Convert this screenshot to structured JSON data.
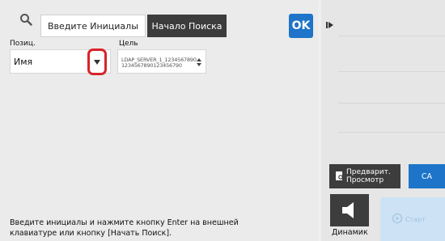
{
  "search": {
    "placeholder": "Введите Инициалы",
    "start_button": "Начало Поиска",
    "ok_button": "OK"
  },
  "fields": {
    "position_label": "Позиц.",
    "position_value": "Имя",
    "target_label": "Цель",
    "target_value_line1": "LDAP_SERVER_1_1234567890",
    "target_value_line2": "1234567890123456790"
  },
  "hint_text": "Введите инициалы и нажмите кнопку Enter на внешней клавиатуре или кнопку [Начать Поиск].",
  "right_panel": {
    "preview_button": "Предварит.\nПросмотр",
    "ca_button": "CA",
    "speaker_label": "Динамик",
    "start_label": "Старт"
  },
  "colors": {
    "accent_blue": "#1d74c9",
    "dark_button": "#3c3c3c",
    "highlight_red": "#d8232a",
    "start_disabled": "#cde3f5"
  },
  "icons": {
    "search": "magnifier",
    "expand": "triangle-right-with-bar",
    "dropdown": "triangle-down",
    "stepper": "up-down-arrows",
    "preview": "document-magnifier",
    "speaker": "speaker",
    "start": "start-circle"
  }
}
